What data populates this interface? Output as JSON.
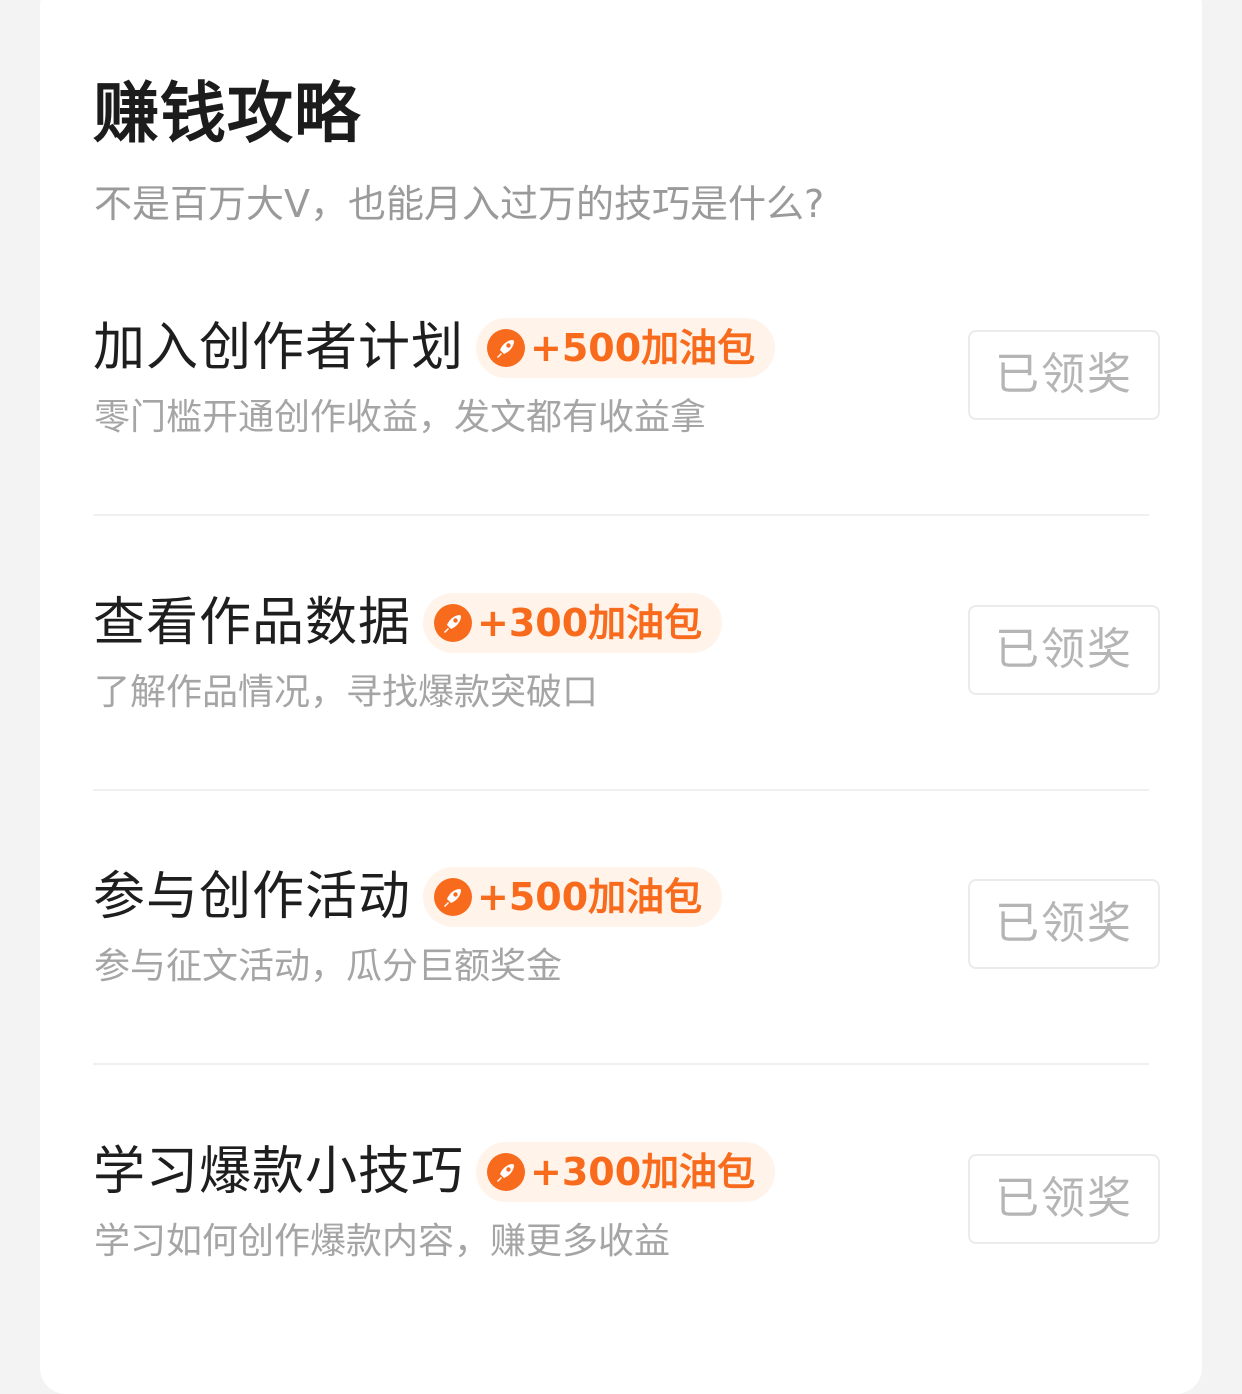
{
  "section": {
    "title": "赚钱攻略",
    "subtitle": "不是百万大V，也能月入过万的技巧是什么?"
  },
  "colors": {
    "reward_text": "#f86b1d",
    "reward_badge_bg": "#fff3ea",
    "claim_text": "#b5b5b5"
  },
  "tasks": [
    {
      "title": "加入创作者计划",
      "reward": "+500加油包",
      "reward_icon": "rocket-icon",
      "description": "零门槛开通创作收益，发文都有收益拿",
      "button_label": "已领奖"
    },
    {
      "title": "查看作品数据",
      "reward": "+300加油包",
      "reward_icon": "rocket-icon",
      "description": "了解作品情况，寻找爆款突破口",
      "button_label": "已领奖"
    },
    {
      "title": "参与创作活动",
      "reward": "+500加油包",
      "reward_icon": "rocket-icon",
      "description": "参与征文活动，瓜分巨额奖金",
      "button_label": "已领奖"
    },
    {
      "title": "学习爆款小技巧",
      "reward": "+300加油包",
      "reward_icon": "rocket-icon",
      "description": "学习如何创作爆款内容，赚更多收益",
      "button_label": "已领奖"
    }
  ]
}
